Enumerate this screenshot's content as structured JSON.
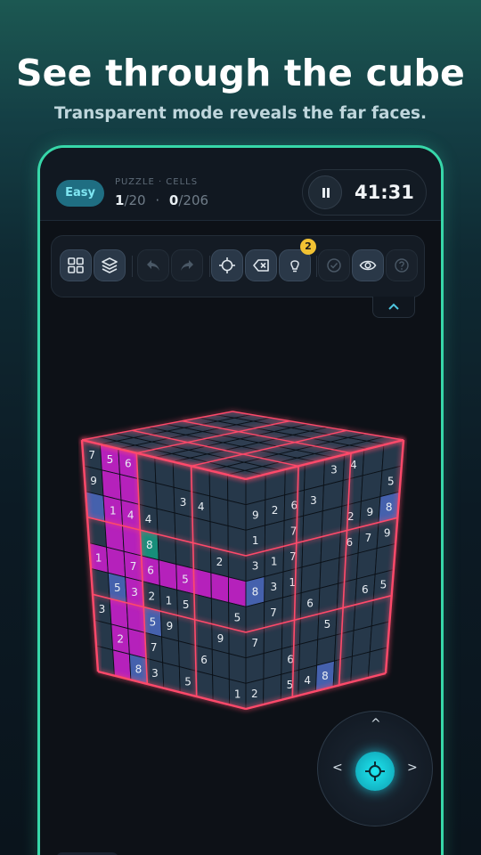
{
  "promo": {
    "headline": "See through the cube",
    "subline": "Transparent mode reveals the far faces."
  },
  "header": {
    "difficulty": "Easy",
    "stats_label": "PUZZLE · CELLS",
    "puzzle_current": "1",
    "puzzle_total": "/20",
    "cells_current": "0",
    "cells_total": "/206",
    "separator": "·",
    "timer": "41:31"
  },
  "toolbar": {
    "hint_count": "2",
    "buttons": [
      "grid-view-icon",
      "layers-icon",
      "undo-icon",
      "redo-icon",
      "locate-icon",
      "erase-icon",
      "hint-icon",
      "check-icon",
      "eye-icon",
      "help-icon"
    ]
  },
  "colors": {
    "accent": "#37d7a9",
    "highlight": "#d425d8",
    "selected": "#1aa58c",
    "cell": "#2d4258",
    "cell_blue": "#5070c8",
    "edge_glow": "#ff4a6a"
  },
  "cube": {
    "top": [
      [
        "",
        "",
        "",
        "",
        "",
        "",
        "",
        "",
        ""
      ],
      [
        "",
        "",
        "",
        "",
        "",
        "",
        "",
        "",
        ""
      ],
      [
        "",
        "",
        "",
        "",
        "",
        "",
        "",
        "",
        ""
      ],
      [
        "",
        "",
        "",
        "",
        "",
        "",
        "",
        "",
        ""
      ],
      [
        "",
        "",
        "",
        "",
        "",
        "",
        "",
        "",
        ""
      ],
      [
        "",
        "",
        "",
        "",
        "",
        "",
        "",
        "",
        ""
      ],
      [
        "",
        "",
        "",
        "",
        "",
        "",
        "",
        "",
        ""
      ],
      [
        "",
        "",
        "",
        "",
        "",
        "",
        "",
        "",
        ""
      ],
      [
        "",
        "",
        "",
        "",
        "",
        "",
        "",
        "",
        ""
      ]
    ],
    "left": [
      [
        "7",
        "5",
        "6",
        "",
        "",
        "",
        "",
        "",
        ""
      ],
      [
        "9",
        "",
        "",
        "",
        "",
        "3",
        "4",
        "",
        ""
      ],
      [
        "",
        "1",
        "4",
        "4",
        "",
        "",
        "",
        "",
        ""
      ],
      [
        "",
        "",
        "",
        "8",
        "",
        "",
        "",
        "2",
        ""
      ],
      [
        "1",
        "",
        "7",
        "6",
        "",
        "5",
        "",
        "",
        ""
      ],
      [
        "",
        "5",
        "3",
        "2",
        "1",
        "5",
        "",
        "",
        "5"
      ],
      [
        "3",
        "",
        "",
        "5",
        "9",
        "",
        "",
        "9",
        ""
      ],
      [
        "",
        "2",
        "",
        "7",
        "",
        "",
        "6",
        "",
        ""
      ],
      [
        "",
        "",
        "8",
        "3",
        "",
        "5",
        "",
        "",
        "1"
      ]
    ],
    "right": [
      [
        "",
        "",
        "",
        "",
        "3",
        "4",
        "",
        ""
      ],
      [
        "9",
        "2",
        "6",
        "3",
        "",
        "",
        "",
        "5"
      ],
      [
        "1",
        "",
        "7",
        "",
        "",
        "2",
        "9",
        "8"
      ],
      [
        "3",
        "1",
        "7",
        "",
        "",
        "6",
        "7",
        "9"
      ],
      [
        "8",
        "3",
        "1",
        "",
        "",
        "",
        "",
        ""
      ],
      [
        "",
        "7",
        "",
        "6",
        "",
        "",
        "6",
        "5"
      ],
      [
        "7",
        "",
        "",
        "",
        "5",
        "",
        "",
        ""
      ],
      [
        "",
        "",
        "6",
        "",
        "",
        "",
        "",
        ""
      ],
      [
        "2",
        "",
        "5",
        "4",
        "8",
        "",
        "",
        ""
      ]
    ],
    "left_highlight_cols": [
      1,
      2
    ],
    "left_highlight_rows": [
      4
    ],
    "left_selected": [
      3,
      3
    ],
    "left_blue": [
      [
        2,
        0
      ],
      [
        5,
        1
      ],
      [
        6,
        3
      ],
      [
        8,
        2
      ]
    ],
    "right_blue": [
      [
        4,
        0
      ],
      [
        2,
        7
      ],
      [
        8,
        4
      ]
    ]
  },
  "joystick": {
    "up": "^",
    "left": "<",
    "right": ">"
  }
}
